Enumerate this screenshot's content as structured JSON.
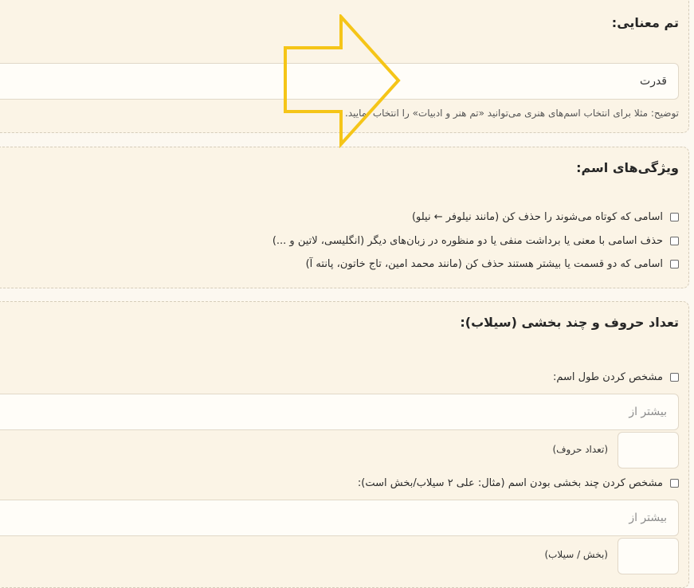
{
  "theme_section": {
    "title": "تم معنایی:",
    "input_value": "قدرت",
    "hint": "توضیح: مثلا برای انتخاب اسم‌های هنری می‌توانید «تم هنر و ادبیات» را انتخاب نمایید."
  },
  "features_section": {
    "title": "ویژگی‌های اسم:",
    "options": [
      "اسامی که کوتاه می‌شوند را حذف کن (مانند نیلوفر ← نیلو)",
      "حذف اسامی با معنی یا برداشت منفی یا دو منظوره در زبان‌های دیگر (انگلیسی، لاتین و ...)",
      "اسامی که دو قسمت یا بیشتر هستند حذف کن (مانند محمد امین، تاج خاتون، پانته آ)"
    ]
  },
  "length_section": {
    "title": "تعداد حروف و چند بخشی (سیلاب):",
    "length_checkbox_label": "مشخص کردن طول اسم:",
    "length_more_placeholder": "بیشتر از",
    "length_unit_label": "(تعداد حروف)",
    "syllable_checkbox_label": "مشخص کردن چند بخشی بودن اسم (مثال: علی ۲ سیلاب/بخش است):",
    "syllable_more_placeholder": "بیشتر از",
    "syllable_unit_label": "(بخش / سیلاب)"
  },
  "annotation": {
    "arrow_color": "#f5c518",
    "arrow_icon": "right-arrow-icon"
  }
}
